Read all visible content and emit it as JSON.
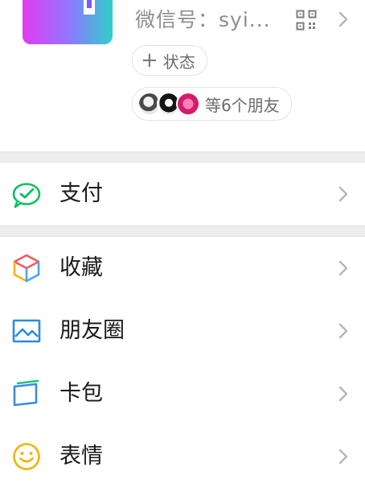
{
  "profile": {
    "wechat_id_text": "微信号：syi...",
    "status_button_label": "状态",
    "status_plus": "+",
    "friends_label": "等6个朋友",
    "avatar_icon": "profile-avatar"
  },
  "menu": {
    "items": [
      {
        "label": "支付",
        "icon": "wechat-pay-icon"
      },
      {
        "label": "收藏",
        "icon": "favorites-cube-icon"
      },
      {
        "label": "朋友圈",
        "icon": "moments-picture-icon"
      },
      {
        "label": "卡包",
        "icon": "card-wallet-icon"
      },
      {
        "label": "表情",
        "icon": "smiley-icon"
      }
    ]
  },
  "colors": {
    "pay_green": "#07c160",
    "moments_blue": "#2a8ae6",
    "cards_blue": "#3b8be6",
    "emoji_yellow": "#f2b400",
    "separator": "#ededed",
    "chevron": "#b6b6b6"
  }
}
